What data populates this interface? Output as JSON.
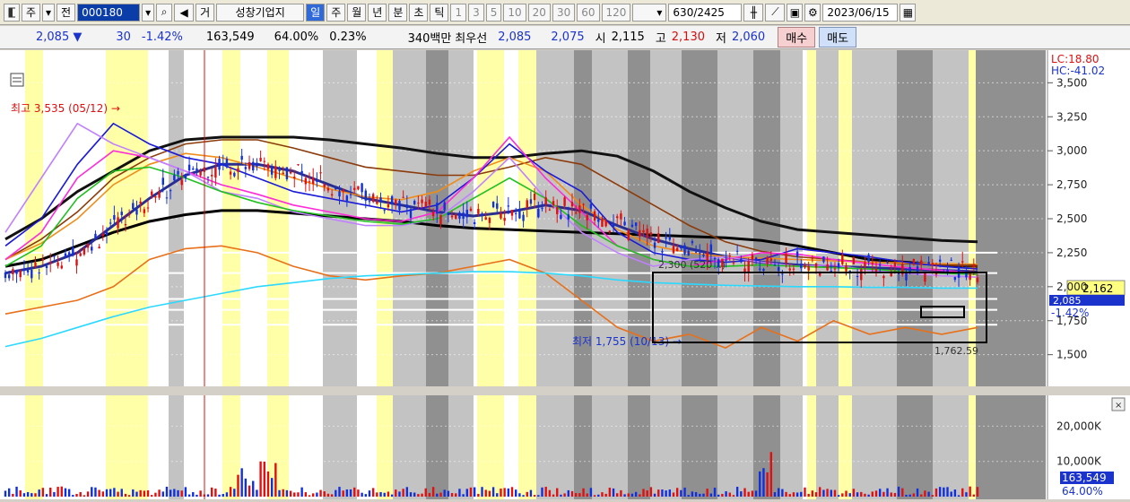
{
  "toolbar": {
    "market_tabs": [
      "주",
      "전"
    ],
    "code": "000180",
    "name": "성창기업지",
    "prefix": "거",
    "periods": [
      "일",
      "주",
      "월",
      "년",
      "분",
      "초",
      "틱"
    ],
    "active_period": "일",
    "nums": [
      "1",
      "3",
      "5",
      "10",
      "20",
      "30",
      "60",
      "120"
    ],
    "count": "630",
    "total": "/2425",
    "date": "2023/06/15"
  },
  "info": {
    "price": "2,085 ▼",
    "change": "30",
    "change_pct": "-1.42%",
    "volume": "163,549",
    "vol_ratio": "64.00%",
    "turnover": "0.23%",
    "amount": "340백만",
    "priority_label": "최우선",
    "sell_quote": "2,085",
    "buy_quote": "2,075",
    "open_label": "시",
    "open": "2,115",
    "high_label": "고",
    "high": "2,130",
    "low_label": "저",
    "low": "2,060",
    "buy_button": "매수",
    "sell_button": "매도"
  },
  "colors": {
    "yellow_band": "#ffff99",
    "gray_band": "#b9b9b9",
    "dark_band": "#7c7c7c",
    "candle_up": "#e01010",
    "candle_down": "#1030e0"
  },
  "chart_data": [
    {
      "type": "line",
      "yscale": "linear",
      "ylim": [
        1300,
        3700
      ],
      "yticks": [
        1500,
        1750,
        2000,
        2250,
        2500,
        2750,
        3000,
        3250,
        3500
      ],
      "ytick_labels": [
        "1,500",
        "1,750",
        "2,000",
        "2,250",
        "2,500",
        "2,750",
        "3,000",
        "3,250",
        "3,500"
      ],
      "corner_labels": [
        "LC:18.80",
        "HC:-41.02"
      ],
      "price_tag": "2,162",
      "price_tag2": "2,085",
      "pct_tag": "-1.42%",
      "annotations": {
        "high": "최고 3,535 (05/12) →",
        "low": "최저 1,755 (10/13) →",
        "mid": "2,300 (520 ..)",
        "box_low": "1,762.59"
      },
      "series": [
        {
          "color": "#000000",
          "values": [
            2150,
            2200,
            2300,
            2400,
            2480,
            2530,
            2560,
            2560,
            2540,
            2520,
            2500,
            2480,
            2450,
            2430,
            2420,
            2410,
            2400,
            2390,
            2380,
            2370,
            2360,
            2340,
            2300,
            2250,
            2200,
            2180,
            2160,
            2150
          ]
        },
        {
          "color": "#2a2f8f",
          "values": [
            2100,
            2150,
            2250,
            2450,
            2650,
            2820,
            2900,
            2900,
            2850,
            2750,
            2650,
            2600,
            2550,
            2520,
            2550,
            2600,
            2560,
            2450,
            2350,
            2280,
            2220,
            2180,
            2160,
            2150,
            2140,
            2130,
            2120,
            2110
          ]
        },
        {
          "color": "#111111",
          "values": [
            2350,
            2500,
            2700,
            2850,
            3000,
            3080,
            3100,
            3100,
            3100,
            3080,
            3050,
            3020,
            2980,
            2950,
            2950,
            2980,
            3000,
            2960,
            2850,
            2700,
            2580,
            2480,
            2420,
            2400,
            2380,
            2360,
            2340,
            2330
          ]
        },
        {
          "color": "#8b3a0a",
          "values": [
            2200,
            2350,
            2550,
            2800,
            2950,
            3050,
            3080,
            3080,
            3020,
            2950,
            2880,
            2850,
            2820,
            2820,
            2880,
            2950,
            2900,
            2750,
            2600,
            2450,
            2330,
            2260,
            2220,
            2200,
            2180,
            2170,
            2160,
            2150
          ]
        },
        {
          "color": "#f08c1a",
          "values": [
            2200,
            2320,
            2500,
            2750,
            2900,
            2980,
            2950,
            2880,
            2800,
            2720,
            2660,
            2640,
            2700,
            2850,
            2950,
            2850,
            2600,
            2420,
            2300,
            2250,
            2220,
            2210,
            2200,
            2190,
            2180,
            2175,
            2170,
            2165
          ]
        },
        {
          "color": "#e8701a",
          "values": [
            1800,
            1850,
            1900,
            2000,
            2200,
            2280,
            2300,
            2250,
            2150,
            2080,
            2050,
            2080,
            2100,
            2150,
            2200,
            2100,
            1900,
            1700,
            1600,
            1650,
            1550,
            1700,
            1600,
            1750,
            1650,
            1700,
            1650,
            1700
          ]
        },
        {
          "color": "#1a1ad8",
          "values": [
            2300,
            2500,
            2900,
            3200,
            3050,
            2950,
            2900,
            2800,
            2700,
            2650,
            2600,
            2550,
            2600,
            2800,
            3050,
            2850,
            2700,
            2400,
            2250,
            2200,
            2180,
            2200,
            2280,
            2250,
            2220,
            2180,
            2150,
            2130
          ]
        },
        {
          "color": "#ff2ad8",
          "values": [
            2200,
            2400,
            2800,
            3000,
            2950,
            2850,
            2750,
            2680,
            2600,
            2550,
            2500,
            2480,
            2550,
            2800,
            3100,
            2800,
            2550,
            2300,
            2200,
            2150,
            2200,
            2250,
            2240,
            2200,
            2170,
            2140,
            2120,
            2100
          ]
        },
        {
          "color": "#c080ff",
          "values": [
            2400,
            2800,
            3200,
            3050,
            2950,
            2850,
            2700,
            2650,
            2550,
            2500,
            2450,
            2450,
            2500,
            2700,
            2950,
            2650,
            2400,
            2250,
            2150,
            2200,
            2220,
            2180,
            2150,
            2160,
            2120,
            2100,
            2080,
            2070
          ]
        },
        {
          "color": "#1fc01f",
          "values": [
            2150,
            2300,
            2650,
            2850,
            2880,
            2800,
            2700,
            2620,
            2560,
            2520,
            2480,
            2460,
            2500,
            2650,
            2800,
            2650,
            2450,
            2300,
            2200,
            2150,
            2150,
            2160,
            2150,
            2140,
            2130,
            2110,
            2100,
            2090
          ]
        },
        {
          "color": "#2bd9ff",
          "values": [
            1560,
            1620,
            1700,
            1780,
            1850,
            1900,
            1950,
            2000,
            2030,
            2060,
            2080,
            2090,
            2100,
            2110,
            2110,
            2100,
            2080,
            2050,
            2030,
            2020,
            2010,
            2005,
            2000,
            2000,
            1995,
            1995,
            1990,
            1990
          ]
        }
      ]
    },
    {
      "type": "bar",
      "yticks": [
        10000,
        20000
      ],
      "ytick_labels": [
        "10,000K",
        "20,000K"
      ],
      "volume_tag": "163,549",
      "vol_pct_tag": "64.00%"
    }
  ]
}
